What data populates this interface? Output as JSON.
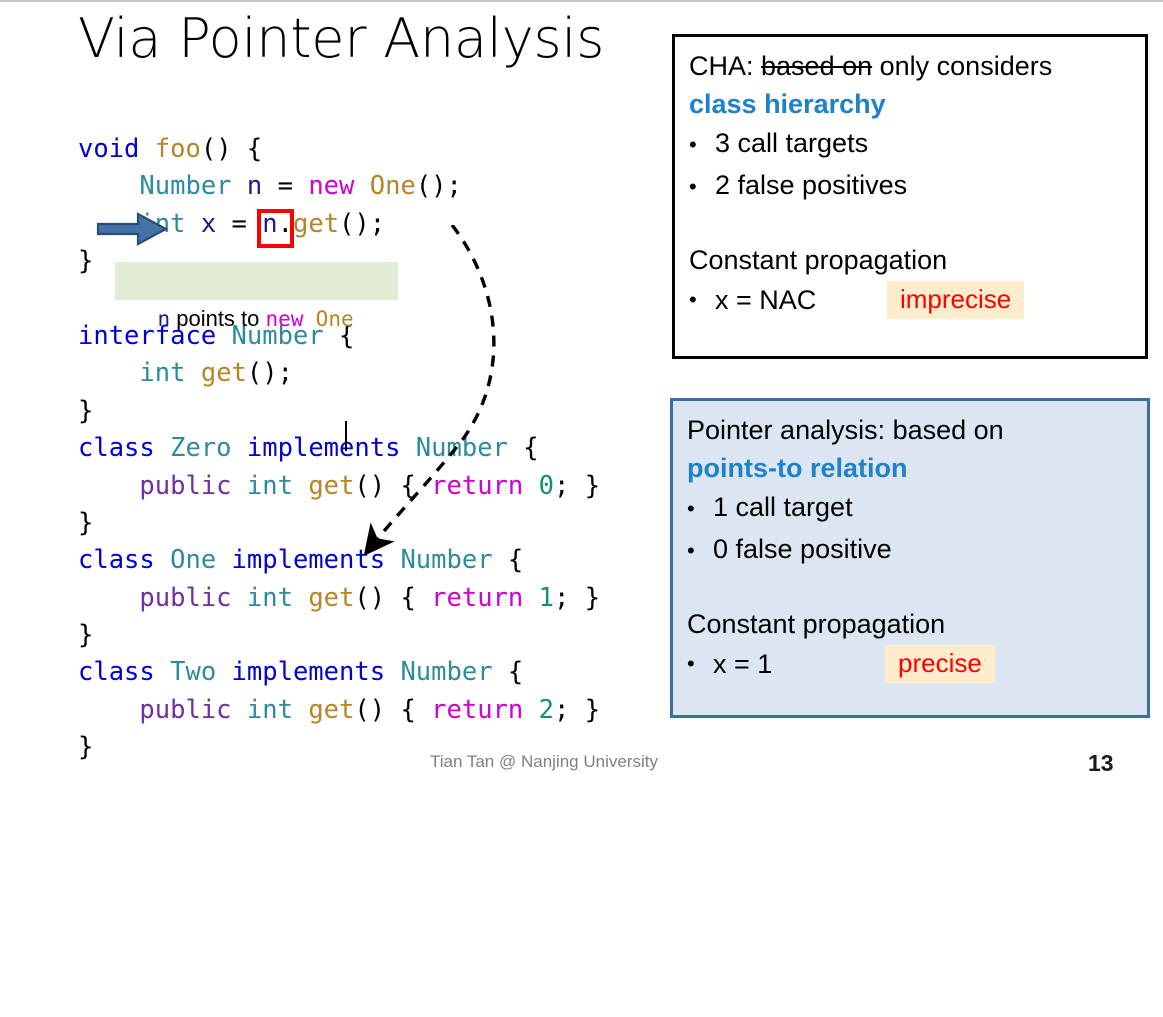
{
  "slide": {
    "title": "Via Pointer Analysis",
    "page_number": "13",
    "footer_author": "Tian Tan @ Nanjing University"
  },
  "code": {
    "lines": [
      [
        {
          "t": "void",
          "c": "kw"
        },
        {
          "t": " ",
          "c": "pun"
        },
        {
          "t": "foo",
          "c": "mth"
        },
        {
          "t": "() {",
          "c": "pun"
        }
      ],
      [
        {
          "t": "    ",
          "c": "pun"
        },
        {
          "t": "Number",
          "c": "typ"
        },
        {
          "t": " ",
          "c": "pun"
        },
        {
          "t": "n",
          "c": "var"
        },
        {
          "t": " = ",
          "c": "pun"
        },
        {
          "t": "new",
          "c": "mag"
        },
        {
          "t": " ",
          "c": "pun"
        },
        {
          "t": "One",
          "c": "mth"
        },
        {
          "t": "();",
          "c": "pun"
        }
      ],
      [
        {
          "t": "    ",
          "c": "pun"
        },
        {
          "t": "int",
          "c": "typ"
        },
        {
          "t": " ",
          "c": "pun"
        },
        {
          "t": "x",
          "c": "var"
        },
        {
          "t": " = ",
          "c": "pun"
        },
        {
          "t": "n",
          "c": "var"
        },
        {
          "t": ".",
          "c": "pun"
        },
        {
          "t": "get",
          "c": "mth"
        },
        {
          "t": "();",
          "c": "pun"
        }
      ],
      [
        {
          "t": "}",
          "c": "pun"
        }
      ],
      [
        {
          "t": " ",
          "c": "pun"
        }
      ],
      [
        {
          "t": "interface",
          "c": "kw"
        },
        {
          "t": " ",
          "c": "pun"
        },
        {
          "t": "Number",
          "c": "typ"
        },
        {
          "t": " {",
          "c": "pun"
        }
      ],
      [
        {
          "t": "    ",
          "c": "pun"
        },
        {
          "t": "int",
          "c": "typ"
        },
        {
          "t": " ",
          "c": "pun"
        },
        {
          "t": "get",
          "c": "mth"
        },
        {
          "t": "();",
          "c": "pun"
        }
      ],
      [
        {
          "t": "}",
          "c": "pun"
        }
      ],
      [
        {
          "t": "class",
          "c": "kw"
        },
        {
          "t": " ",
          "c": "pun"
        },
        {
          "t": "Zero",
          "c": "typ"
        },
        {
          "t": " ",
          "c": "pun"
        },
        {
          "t": "implements",
          "c": "kw"
        },
        {
          "t": " ",
          "c": "pun"
        },
        {
          "t": "Number",
          "c": "typ"
        },
        {
          "t": " {",
          "c": "pun"
        }
      ],
      [
        {
          "t": "    ",
          "c": "pun"
        },
        {
          "t": "public",
          "c": "kwp"
        },
        {
          "t": " ",
          "c": "pun"
        },
        {
          "t": "int",
          "c": "typ"
        },
        {
          "t": " ",
          "c": "pun"
        },
        {
          "t": "get",
          "c": "mth"
        },
        {
          "t": "() { ",
          "c": "pun"
        },
        {
          "t": "return",
          "c": "mag"
        },
        {
          "t": " ",
          "c": "pun"
        },
        {
          "t": "0",
          "c": "num"
        },
        {
          "t": "; }",
          "c": "pun"
        }
      ],
      [
        {
          "t": "}",
          "c": "pun"
        }
      ],
      [
        {
          "t": "class",
          "c": "kw"
        },
        {
          "t": " ",
          "c": "pun"
        },
        {
          "t": "One",
          "c": "typ"
        },
        {
          "t": " ",
          "c": "pun"
        },
        {
          "t": "implements",
          "c": "kw"
        },
        {
          "t": " ",
          "c": "pun"
        },
        {
          "t": "Number",
          "c": "typ"
        },
        {
          "t": " {",
          "c": "pun"
        }
      ],
      [
        {
          "t": "    ",
          "c": "pun"
        },
        {
          "t": "public",
          "c": "kwp"
        },
        {
          "t": " ",
          "c": "pun"
        },
        {
          "t": "int",
          "c": "typ"
        },
        {
          "t": " ",
          "c": "pun"
        },
        {
          "t": "get",
          "c": "mth"
        },
        {
          "t": "() { ",
          "c": "pun"
        },
        {
          "t": "return",
          "c": "mag"
        },
        {
          "t": " ",
          "c": "pun"
        },
        {
          "t": "1",
          "c": "num"
        },
        {
          "t": "; }",
          "c": "pun"
        }
      ],
      [
        {
          "t": "}",
          "c": "pun"
        }
      ],
      [
        {
          "t": "class",
          "c": "kw"
        },
        {
          "t": " ",
          "c": "pun"
        },
        {
          "t": "Two",
          "c": "typ"
        },
        {
          "t": " ",
          "c": "pun"
        },
        {
          "t": "implements",
          "c": "kw"
        },
        {
          "t": " ",
          "c": "pun"
        },
        {
          "t": "Number",
          "c": "typ"
        },
        {
          "t": " {",
          "c": "pun"
        }
      ],
      [
        {
          "t": "    ",
          "c": "pun"
        },
        {
          "t": "public",
          "c": "kwp"
        },
        {
          "t": " ",
          "c": "pun"
        },
        {
          "t": "int",
          "c": "typ"
        },
        {
          "t": " ",
          "c": "pun"
        },
        {
          "t": "get",
          "c": "mth"
        },
        {
          "t": "() { ",
          "c": "pun"
        },
        {
          "t": "return",
          "c": "mag"
        },
        {
          "t": " ",
          "c": "pun"
        },
        {
          "t": "2",
          "c": "num"
        },
        {
          "t": "; }",
          "c": "pun"
        }
      ],
      [
        {
          "t": "}",
          "c": "pun"
        }
      ]
    ]
  },
  "callout": {
    "prefix_var": "n",
    "text_mid": " points to ",
    "new_kw": "new",
    "gap": "  ",
    "type_name": "One"
  },
  "cha_box": {
    "heading_prefix": "CHA: ",
    "heading_struck": "based on",
    "heading_rest": " only considers",
    "heading_emphasis": "class hierarchy",
    "bullets": [
      {
        "marker": "•",
        "text": "3 call targets"
      },
      {
        "marker": "•",
        "text": "2 false positives"
      }
    ],
    "analysis_label": "Constant propagation",
    "result_marker": "•",
    "result_value": "x = NAC",
    "result_tag": "imprecise",
    "meme_name": "confused-jackie-chan-meme"
  },
  "pta_box": {
    "heading_prefix": "Pointer analysis: based on",
    "heading_emphasis": "points-to relation",
    "bullets": [
      {
        "marker": "•",
        "text": "1 call target"
      },
      {
        "marker": "•",
        "text": "0 false positive"
      }
    ],
    "analysis_label": "Constant propagation",
    "result_marker": "•",
    "result_value": "x = 1",
    "result_tag": "precise",
    "meme_name": "yao-ming-face-meme"
  },
  "annotations": {
    "current_statement_arrow": "blue-right-arrow",
    "receiver_highlight": "red-box-around-n",
    "points_to_edge": "dashed-curved-arrow"
  },
  "colors": {
    "accent_blue": "#1f82c8",
    "box_blue_fill": "#dce6f2",
    "box_blue_border": "#3a6ea5",
    "callout_green": "#e2ecd4",
    "tag_bg": "#ffeccd",
    "tag_text": "#ff0000",
    "highlight_red": "#ff0000",
    "arrow_blue": "#3a6ea5"
  }
}
